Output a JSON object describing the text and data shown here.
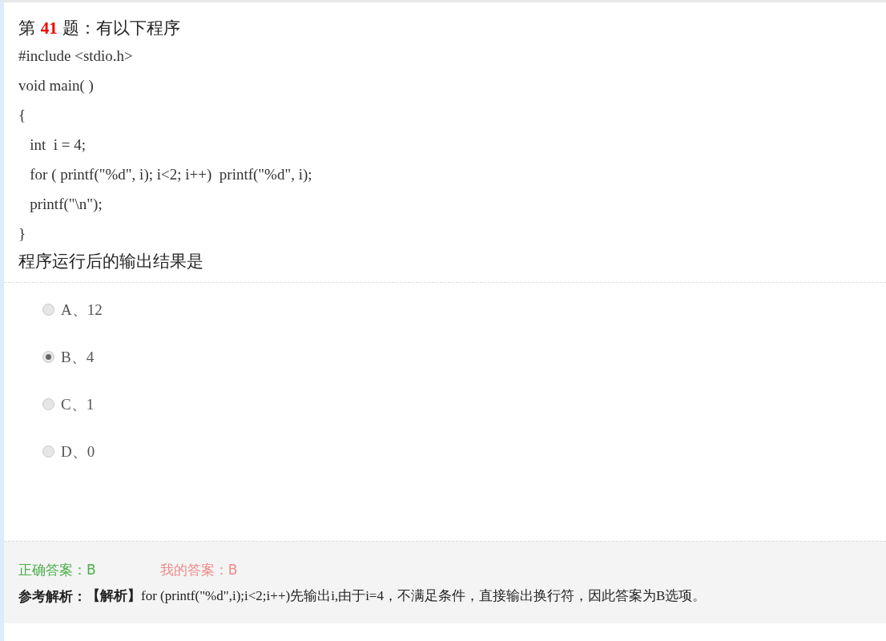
{
  "question": {
    "prefix": "第",
    "number": "41",
    "suffix": "题：有以下程序",
    "code": [
      "#include <stdio.h>",
      "void main( )",
      "{",
      "   int  i = 4;",
      "   for ( printf(\"%d\", i); i<2; i++)  printf(\"%d\", i);",
      "   printf(\"\\n\");",
      "}"
    ],
    "prompt": "程序运行后的输出结果是"
  },
  "options": [
    {
      "label": "A、12",
      "selected": false
    },
    {
      "label": "B、4",
      "selected": true
    },
    {
      "label": "C、1",
      "selected": false
    },
    {
      "label": "D、0",
      "selected": false
    }
  ],
  "answer": {
    "correct": "正确答案：B",
    "mine": "我的答案：B",
    "explanation_label": "参考解析：",
    "explanation": "**【解析】**for (printf(\"%d\",i);i<2;i++)先输出i,由于i=4，不满足条件，直接输出换行符，因此答案为B选项。"
  }
}
